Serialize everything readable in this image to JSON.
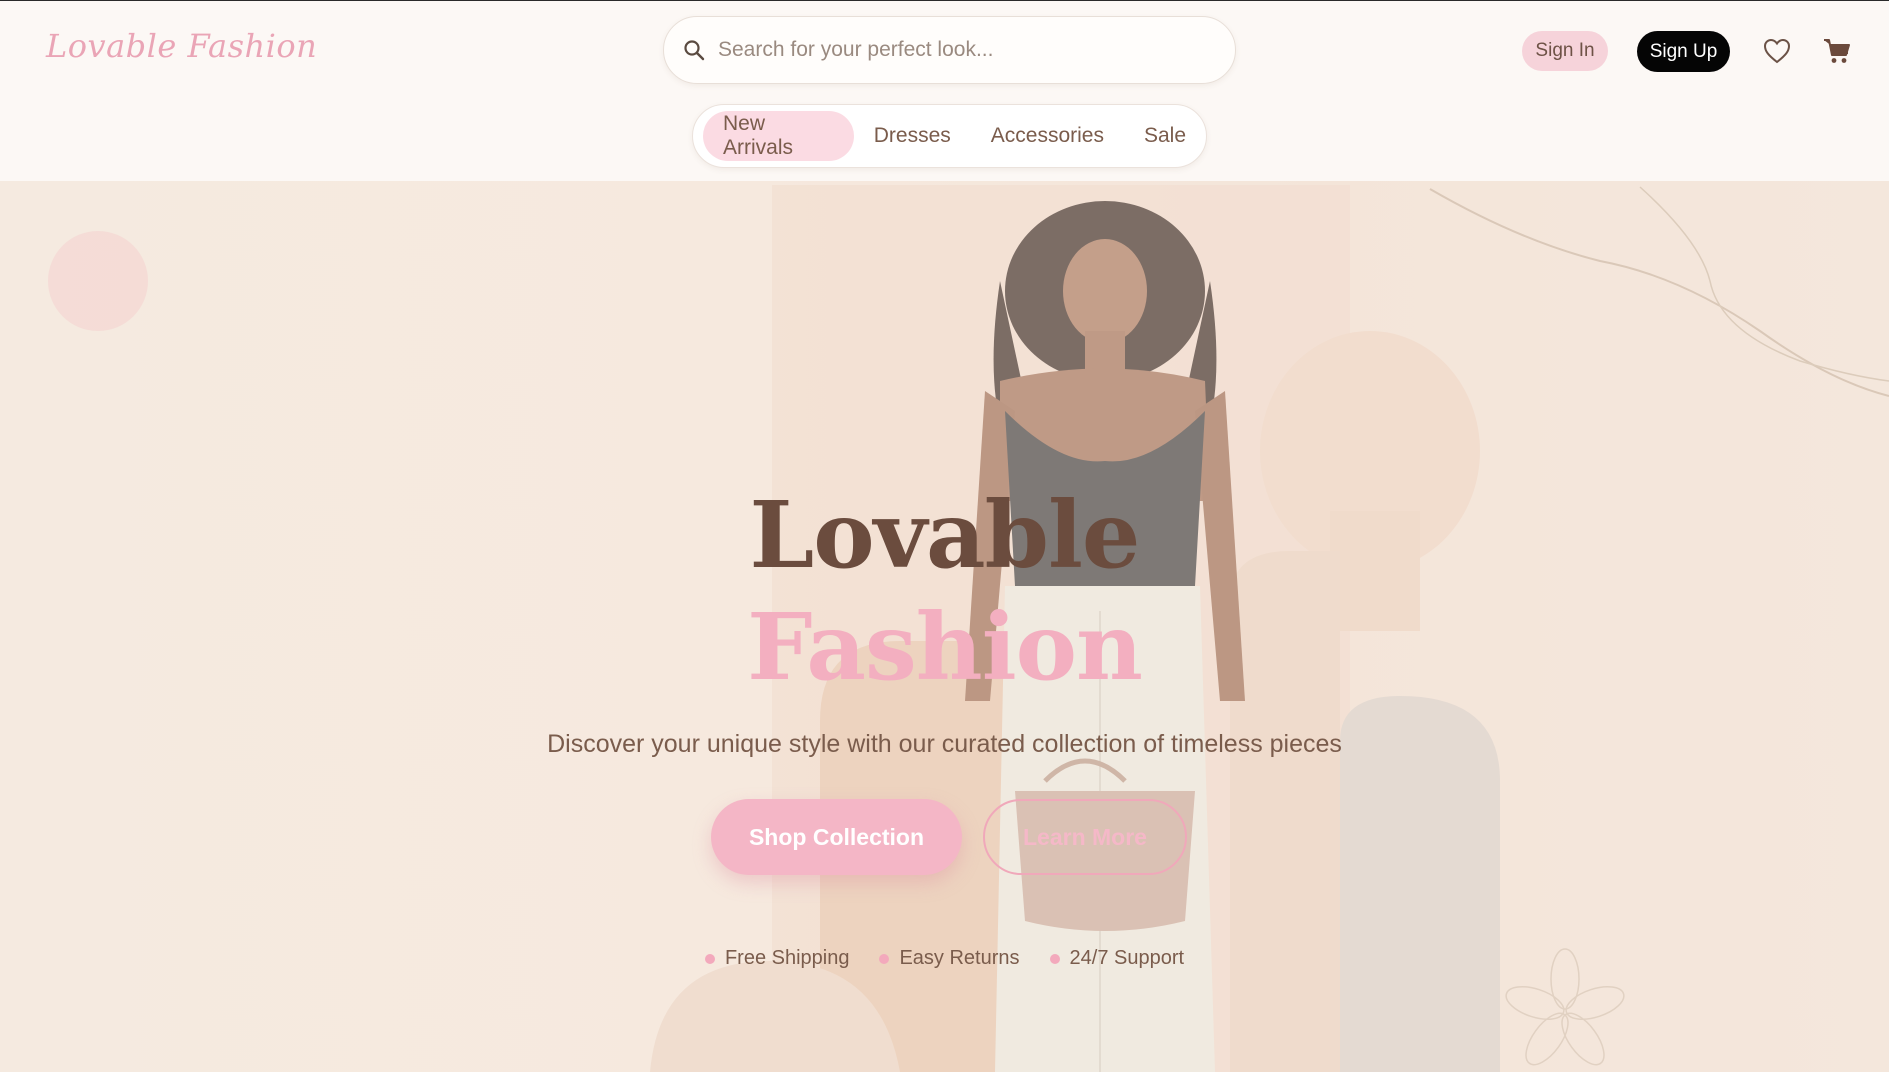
{
  "header": {
    "logo": "Lovable Fashion",
    "search_placeholder": "Search for your perfect look...",
    "sign_in": "Sign In",
    "sign_up": "Sign Up"
  },
  "nav": {
    "items": [
      {
        "label": "New Arrivals",
        "active": true
      },
      {
        "label": "Dresses",
        "active": false
      },
      {
        "label": "Accessories",
        "active": false
      },
      {
        "label": "Sale",
        "active": false
      }
    ]
  },
  "hero": {
    "title_line1": "Lovable",
    "title_line2": "Fashion",
    "subtitle": "Discover your unique style with our curated collection of timeless pieces",
    "primary_button": "Shop Collection",
    "secondary_button": "Learn More",
    "features": [
      "Free Shipping",
      "Easy Returns",
      "24/7 Support"
    ]
  },
  "icons": {
    "search": "search-icon",
    "wishlist": "heart-icon",
    "cart": "cart-icon"
  },
  "colors": {
    "accent_pink": "#f4b6c6",
    "brand_brown": "#6b4c3e",
    "signup_bg": "#050505"
  }
}
